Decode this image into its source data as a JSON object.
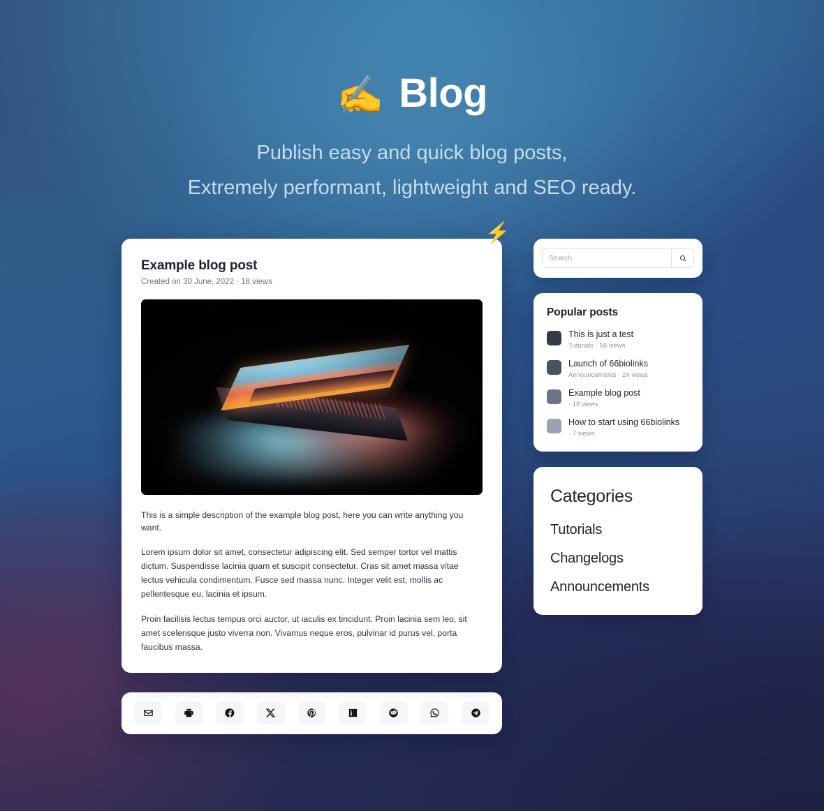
{
  "hero": {
    "emoji": "✍️",
    "emoji_name": "writing-hand-emoji",
    "title": "Blog",
    "subtitle_line1": "Publish easy and quick blog posts,",
    "subtitle_line2": "Extremely performant, lightweight and SEO ready."
  },
  "decor": {
    "bolt_emoji": "⚡"
  },
  "post": {
    "title": "Example blog post",
    "meta": "Created on 30 June, 2022 · 18 views",
    "image_alt": "laptop glowing in a dark room",
    "lead": "This is a simple description of the example blog post, here you can write anything you want.",
    "paragraph1": "Lorem ipsum dolor sit amet, consectetur adipiscing elit. Sed semper tortor vel mattis dictum. Suspendisse lacinia quam et suscipit consectetur. Cras sit amet massa vitae lectus vehicula condimentum. Fusce sed massa nunc. Integer velit est, mollis ac pellentesque eu, lacinia et ipsum.",
    "paragraph2": "Proin facilisis lectus tempus orci auctor, ut iaculis ex tincidunt. Proin lacinia sem leo, sit amet scelerisque justo viverra non. Vivamus neque eros, pulvinar id purus vel, porta faucibus massa."
  },
  "share": {
    "buttons": [
      {
        "name": "email-share-button",
        "icon": "envelope-icon",
        "label": "Email"
      },
      {
        "name": "print-button",
        "icon": "printer-icon",
        "label": "Print"
      },
      {
        "name": "facebook-share-button",
        "icon": "facebook-icon",
        "label": "Facebook"
      },
      {
        "name": "x-share-button",
        "icon": "x-twitter-icon",
        "label": "X"
      },
      {
        "name": "pinterest-share-button",
        "icon": "pinterest-icon",
        "label": "Pinterest"
      },
      {
        "name": "linkedin-share-button",
        "icon": "linkedin-icon",
        "label": "LinkedIn"
      },
      {
        "name": "reddit-share-button",
        "icon": "reddit-icon",
        "label": "Reddit"
      },
      {
        "name": "whatsapp-share-button",
        "icon": "whatsapp-icon",
        "label": "WhatsApp"
      },
      {
        "name": "telegram-share-button",
        "icon": "telegram-icon",
        "label": "Telegram"
      }
    ]
  },
  "search": {
    "value": "",
    "placeholder": "Search",
    "button_icon": "search-icon"
  },
  "popular": {
    "title": "Popular posts",
    "items": [
      {
        "title": "This is just a test",
        "meta": "Tutorials · 58 views",
        "thumb": "#343a46"
      },
      {
        "title": "Launch of 66biolinks",
        "meta": "Announcements · 24 views",
        "thumb": "#4a5262"
      },
      {
        "title": "Example blog post",
        "meta": "· 18 views",
        "thumb": "#6b7489"
      },
      {
        "title": "How to start using 66biolinks",
        "meta": "· 7 views",
        "thumb": "#9aa3b4"
      }
    ]
  },
  "categories": {
    "title": "Categories",
    "items": [
      "Tutorials",
      "Changelogs",
      "Announcements"
    ]
  },
  "colors": {
    "card_bg": "#ffffff",
    "hero_title": "#ffffff",
    "hero_sub": "#c5dced",
    "bg_top": "#3f82ad",
    "bg_bottom_right": "#1f2447",
    "bg_bottom_left": "#4d2f55"
  }
}
